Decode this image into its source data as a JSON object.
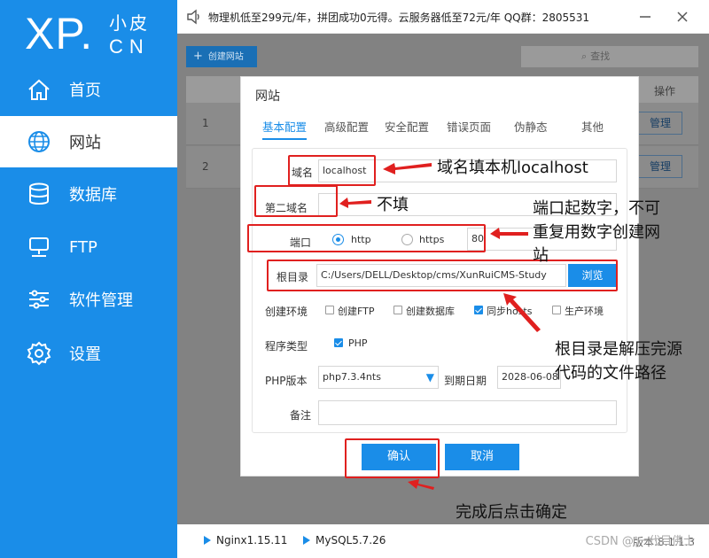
{
  "logo": {
    "main": "XP.",
    "small": "小皮",
    "cn": "CN"
  },
  "sidebar": {
    "items": [
      {
        "label": "首页",
        "icon": "home-icon"
      },
      {
        "label": "网站",
        "icon": "globe-icon"
      },
      {
        "label": "数据库",
        "icon": "database-icon"
      },
      {
        "label": "FTP",
        "icon": "server-icon"
      },
      {
        "label": "软件管理",
        "icon": "sliders-icon"
      },
      {
        "label": "设置",
        "icon": "gear-icon"
      }
    ],
    "active": "网站"
  },
  "topbar": {
    "notice": "物理机低至299元/年，拼团成功0元得。云服务器低至72元/年  QQ群：2805531"
  },
  "toolbar": {
    "create_label": "创建网站",
    "search_label": "查找"
  },
  "table": {
    "op_header": "操作",
    "rows": [
      {
        "num": "1",
        "action": "管理"
      },
      {
        "num": "2",
        "action": "管理"
      }
    ]
  },
  "dialog": {
    "title": "网站",
    "tabs": [
      "基本配置",
      "高级配置",
      "安全配置",
      "错误页面",
      "伪静态",
      "其他"
    ],
    "active_tab": "基本配置",
    "domain": {
      "label": "域名",
      "value": "localhost"
    },
    "second_domain": {
      "label": "第二域名",
      "value": ""
    },
    "port": {
      "label": "端口",
      "http": "http",
      "https": "https",
      "value": "80",
      "selected": "http"
    },
    "root": {
      "label": "根目录",
      "value": "C:/Users/DELL/Desktop/cms/XunRuiCMS-Study",
      "browse": "浏览"
    },
    "env": {
      "label": "创建环境",
      "options": [
        {
          "label": "创建FTP",
          "checked": false
        },
        {
          "label": "创建数据库",
          "checked": false
        },
        {
          "label": "同步hosts",
          "checked": true
        },
        {
          "label": "生产环境",
          "checked": false
        }
      ]
    },
    "program": {
      "label": "程序类型",
      "option": "PHP",
      "checked": true
    },
    "php": {
      "label": "PHP版本",
      "value": "php7.3.4nts",
      "expire_label": "到期日期",
      "expire_value": "2028-06-08"
    },
    "remark": {
      "label": "备注",
      "value": ""
    },
    "confirm": "确认",
    "cancel": "取消"
  },
  "annotations": {
    "domain": "域名填本机localhost",
    "second": "不填",
    "port_line1": "端口起数字，不可",
    "port_line2": "重复用数字创建网",
    "port_line3": "站",
    "root_line1": "根目录是解压完源",
    "root_line2": "代码的文件路径",
    "confirm": "完成后点击确定"
  },
  "statusbar": {
    "nginx": "Nginx1.15.11",
    "mysql": "MySQL5.7.26",
    "version": "版本:8.1.1.3"
  },
  "watermark": "CSDN @ 一代目佛士",
  "colors": {
    "accent": "#1a8de8",
    "annotation": "#e0201f"
  }
}
